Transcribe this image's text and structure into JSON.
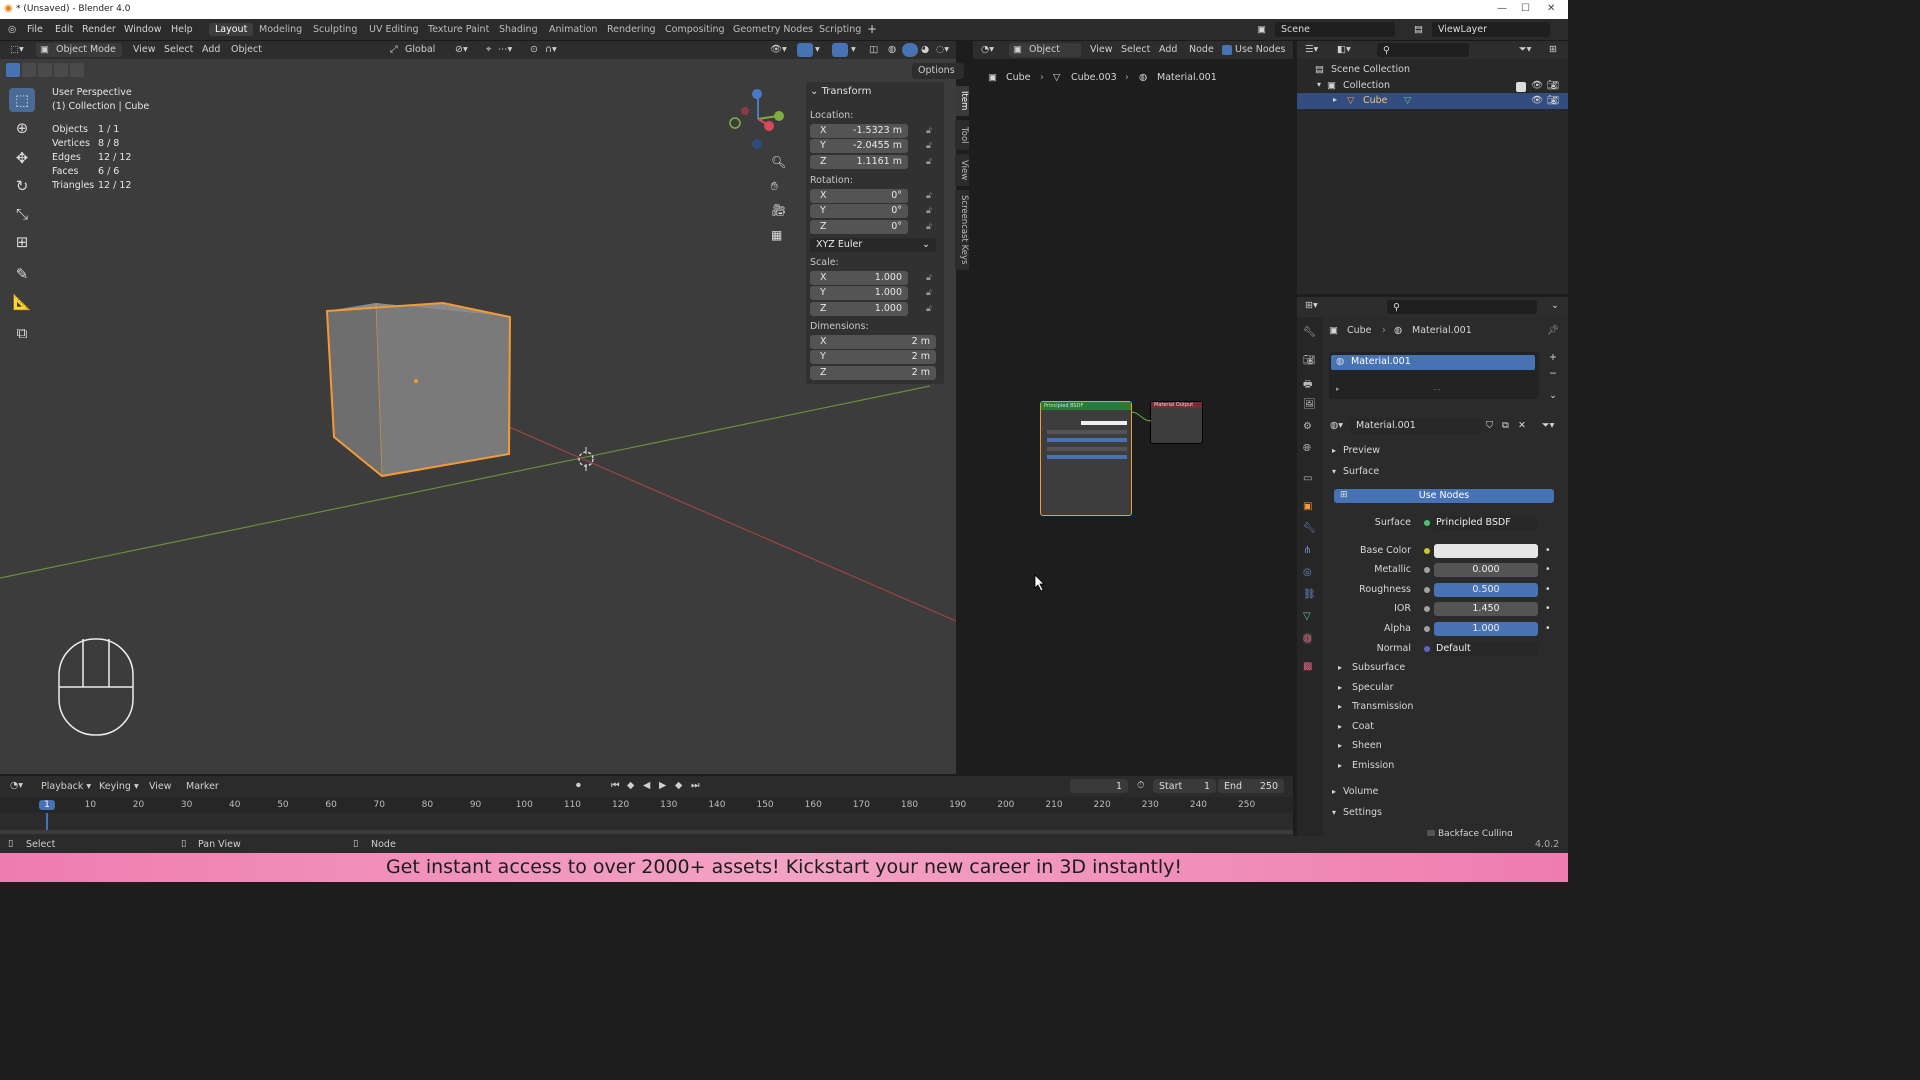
{
  "window": {
    "title": "* (Unsaved) - Blender 4.0"
  },
  "menu": [
    "File",
    "Edit",
    "Render",
    "Window",
    "Help"
  ],
  "workspaces": [
    "Layout",
    "Modeling",
    "Sculpting",
    "UV Editing",
    "Texture Paint",
    "Shading",
    "Animation",
    "Rendering",
    "Compositing",
    "Geometry Nodes",
    "Scripting"
  ],
  "active_workspace": "Layout",
  "scene": {
    "label": "Scene",
    "view_layer": "ViewLayer"
  },
  "viewport": {
    "mode": "Object Mode",
    "menus": [
      "View",
      "Select",
      "Add",
      "Object"
    ],
    "orientation": "Global",
    "options_label": "Options",
    "perspective": "User Perspective",
    "collection": "(1) Collection | Cube",
    "stats": [
      {
        "label": "Objects",
        "value": "1 / 1"
      },
      {
        "label": "Vertices",
        "value": "8 / 8"
      },
      {
        "label": "Edges",
        "value": "12 / 12"
      },
      {
        "label": "Faces",
        "value": "6 / 6"
      },
      {
        "label": "Triangles",
        "value": "12 / 12"
      }
    ]
  },
  "transform": {
    "title": "Transform",
    "location_label": "Location:",
    "location": {
      "x": "-1.5323 m",
      "y": "-2.0455 m",
      "z": "1.1161 m"
    },
    "rotation_label": "Rotation:",
    "rotation": {
      "x": "0°",
      "y": "0°",
      "z": "0°"
    },
    "rotation_mode": "XYZ Euler",
    "scale_label": "Scale:",
    "scale": {
      "x": "1.000",
      "y": "1.000",
      "z": "1.000"
    },
    "dimensions_label": "Dimensions:",
    "dimensions": {
      "x": "2 m",
      "y": "2 m",
      "z": "2 m"
    }
  },
  "sidebar_tabs": [
    "Item",
    "Tool",
    "View",
    "Screencast Keys"
  ],
  "node_editor": {
    "type": "Object",
    "menus": [
      "View",
      "Select",
      "Add",
      "Node"
    ],
    "use_nodes": "Use Nodes",
    "breadcrumb": [
      "Cube",
      "Cube.003",
      "Material.001"
    ],
    "bsdf_title": "Principled BSDF",
    "output_title": "Material Output"
  },
  "outliner": {
    "scene_collection": "Scene Collection",
    "collection": "Collection",
    "cube": "Cube"
  },
  "properties": {
    "breadcrumb": [
      "Cube",
      "Material.001"
    ],
    "slot": "Material.001",
    "material_name": "Material.001",
    "preview": "Preview",
    "surface_section": "Surface",
    "use_nodes": "Use Nodes",
    "surface_label": "Surface",
    "surface_value": "Principled BSDF",
    "base_color_label": "Base Color",
    "metallic_label": "Metallic",
    "metallic": "0.000",
    "roughness_label": "Roughness",
    "roughness": "0.500",
    "ior_label": "IOR",
    "ior": "1.450",
    "alpha_label": "Alpha",
    "alpha": "1.000",
    "normal_label": "Normal",
    "normal": "Default",
    "subsections": [
      "Subsurface",
      "Specular",
      "Transmission",
      "Coat",
      "Sheen",
      "Emission"
    ],
    "volume": "Volume",
    "settings": "Settings",
    "backface": "Backface Culling"
  },
  "timeline": {
    "menus": [
      "Playback",
      "Keying",
      "View",
      "Marker"
    ],
    "current_frame": "1",
    "start_label": "Start",
    "start": "1",
    "end_label": "End",
    "end": "250",
    "ticks": [
      "1",
      "10",
      "20",
      "30",
      "40",
      "50",
      "60",
      "70",
      "80",
      "90",
      "100",
      "110",
      "120",
      "130",
      "140",
      "150",
      "160",
      "170",
      "180",
      "190",
      "200",
      "210",
      "220",
      "230",
      "240",
      "250"
    ]
  },
  "statusbar": {
    "select": "Select",
    "pan": "Pan View",
    "node": "Node",
    "version": "4.0.2"
  },
  "banner": "Get instant access to over 2000+ assets! Kickstart your new career in 3D instantly!",
  "colors": {
    "accent": "#4772b3",
    "selection_orange": "#f29a38",
    "banner": "#ef7cb1"
  }
}
